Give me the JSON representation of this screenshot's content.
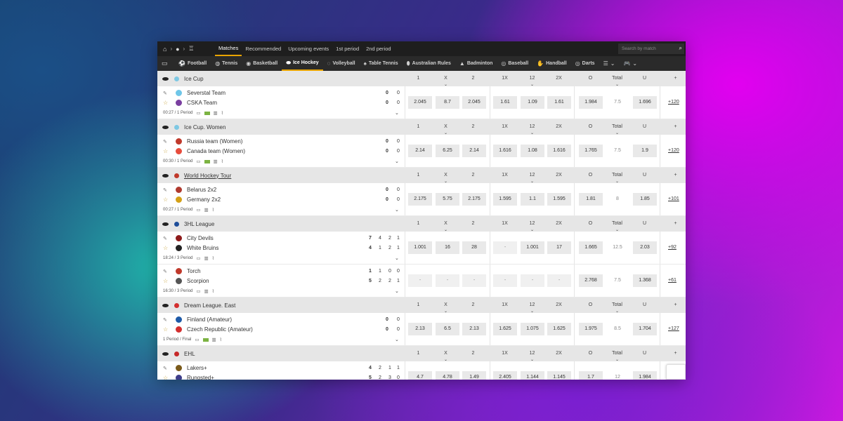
{
  "topbar": {
    "tabs": [
      "Matches",
      "Recommended",
      "Upcoming events",
      "1st period",
      "2nd period"
    ],
    "search_placeholder": "Search by match"
  },
  "sports": [
    {
      "label": "Football",
      "icon": "soccer-ball-icon"
    },
    {
      "label": "Tennis",
      "icon": "tennis-icon"
    },
    {
      "label": "Basketball",
      "icon": "basketball-icon"
    },
    {
      "label": "Ice Hockey",
      "icon": "puck-icon",
      "active": true
    },
    {
      "label": "Volleyball",
      "icon": "volleyball-icon"
    },
    {
      "label": "Table Tennis",
      "icon": "table-tennis-icon"
    },
    {
      "label": "Australian Rules",
      "icon": "rugby-ball-icon"
    },
    {
      "label": "Badminton",
      "icon": "shuttlecock-icon"
    },
    {
      "label": "Baseball",
      "icon": "baseball-icon"
    },
    {
      "label": "Handball",
      "icon": "handball-icon"
    },
    {
      "label": "Darts",
      "icon": "darts-icon"
    }
  ],
  "columns": [
    "1",
    "X",
    "2",
    "1X",
    "12",
    "2X",
    "O",
    "Total",
    "U",
    "+"
  ],
  "groups": [
    {
      "name": "Ice Cup",
      "link": false,
      "flag_color": "#7ec8e3",
      "matches": [
        {
          "team1": "Severstal Team",
          "team2": "CSKA Team",
          "logo1": "#6fc6e8",
          "logo2": "#7a3fa0",
          "scores1": [
            "0",
            "0"
          ],
          "scores2": [
            "0",
            "0"
          ],
          "status": "00:27 / 1 Period",
          "green": true,
          "odds": [
            "2.045",
            "8.7",
            "2.045",
            "1.61",
            "1.09",
            "1.61",
            "1.984",
            "7.5",
            "1.696"
          ],
          "more": "+120"
        }
      ]
    },
    {
      "name": "Ice Cup. Women",
      "link": false,
      "flag_color": "#7ec8e3",
      "matches": [
        {
          "team1": "Russia team (Women)",
          "team2": "Canada team (Women)",
          "logo1": "#c0392b",
          "logo2": "#e74c3c",
          "scores1": [
            "0",
            "0"
          ],
          "scores2": [
            "0",
            "0"
          ],
          "status": "00:30 / 1 Period",
          "green": true,
          "odds": [
            "2.14",
            "6.25",
            "2.14",
            "1.616",
            "1.08",
            "1.616",
            "1.765",
            "7.5",
            "1.9"
          ],
          "more": "+120"
        }
      ]
    },
    {
      "name": "World Hockey Tour",
      "link": true,
      "flag_color": "#c0392b",
      "matches": [
        {
          "team1": "Belarus 2x2",
          "team2": "Germany 2x2",
          "logo1": "#b03a2e",
          "logo2": "#d4a017",
          "scores1": [
            "0",
            "0"
          ],
          "scores2": [
            "0",
            "0"
          ],
          "status": "00:27 / 1 Period",
          "green": false,
          "odds": [
            "2.175",
            "5.75",
            "2.175",
            "1.595",
            "1.1",
            "1.595",
            "1.81",
            "8",
            "1.85"
          ],
          "more": "+101"
        }
      ]
    },
    {
      "name": "3HL League",
      "link": false,
      "flag_color": "#1f4e9a",
      "matches": [
        {
          "team1": "City Devils",
          "team2": "White Bruins",
          "logo1": "#8e1b1b",
          "logo2": "#222222",
          "scores1": [
            "7",
            "4",
            "2",
            "1"
          ],
          "scores2": [
            "4",
            "1",
            "2",
            "1"
          ],
          "status": "18:24 / 3 Period",
          "green": false,
          "odds": [
            "1.001",
            "16",
            "28",
            "-",
            "1.001",
            "17",
            "1.665",
            "12.5",
            "2.03"
          ],
          "more": "+92"
        },
        {
          "team1": "Torch",
          "team2": "Scorpion",
          "logo1": "#c0392b",
          "logo2": "#555555",
          "scores1": [
            "1",
            "1",
            "0",
            "0"
          ],
          "scores2": [
            "5",
            "2",
            "2",
            "1"
          ],
          "status": "16:30 / 3 Period",
          "green": false,
          "odds": [
            "-",
            "-",
            "-",
            "-",
            "-",
            "-",
            "2.768",
            "7.5",
            "1.368"
          ],
          "more": "+61"
        }
      ]
    },
    {
      "name": "Dream League. East",
      "link": false,
      "flag_color": "#d32f2f",
      "matches": [
        {
          "team1": "Finland (Amateur)",
          "team2": "Czech Republic (Amateur)",
          "logo1": "#1e5aa8",
          "logo2": "#d32f2f",
          "scores1": [
            "0",
            "0"
          ],
          "scores2": [
            "0",
            "0"
          ],
          "status": "1 Period / Final",
          "green": true,
          "odds": [
            "2.13",
            "6.5",
            "2.13",
            "1.625",
            "1.075",
            "1.625",
            "1.975",
            "8.5",
            "1.704"
          ],
          "more": "+127"
        }
      ]
    },
    {
      "name": "EHL",
      "link": false,
      "flag_color": "#c62828",
      "matches": [
        {
          "team1": "Lakers+",
          "team2": "Rungsted+",
          "logo1": "#7a5a1a",
          "logo2": "#3d3d8a",
          "scores1": [
            "4",
            "2",
            "1",
            "1"
          ],
          "scores2": [
            "5",
            "2",
            "3",
            "0"
          ],
          "status": "",
          "green": false,
          "odds": [
            "4.7",
            "4.78",
            "1.49",
            "2.405",
            "1.144",
            "1.145",
            "1.7",
            "12",
            "1.984"
          ],
          "more": ""
        }
      ]
    }
  ],
  "accent": "#e9a400"
}
